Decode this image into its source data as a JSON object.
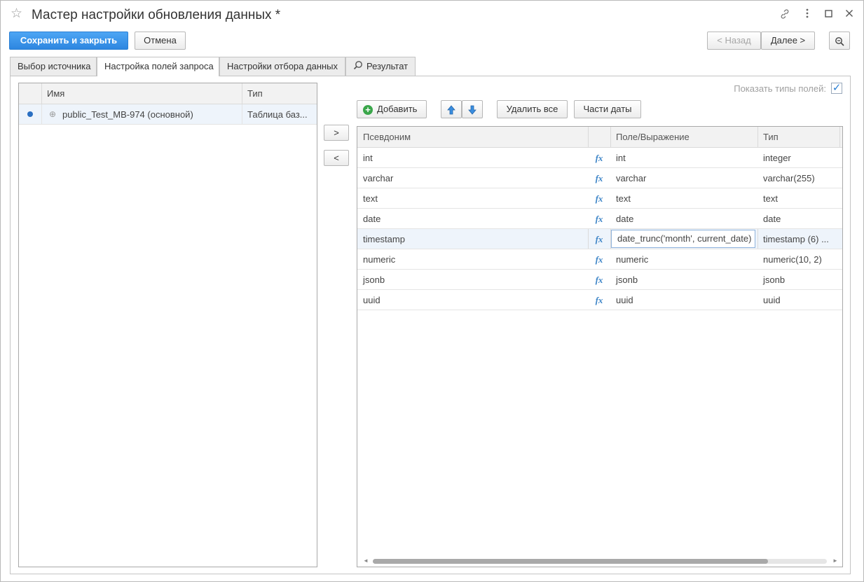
{
  "window": {
    "title": "Мастер настройки обновления данных *",
    "icons": [
      "star-icon",
      "link-icon",
      "more-icon",
      "maximize-icon",
      "close-icon"
    ]
  },
  "toolbar": {
    "save_close": "Сохранить и закрыть",
    "cancel": "Отмена",
    "back": "< Назад",
    "next": "Далее >",
    "zoom_icon": "magnifier-icon"
  },
  "tabs": [
    {
      "label": "Выбор источника"
    },
    {
      "label": "Настройка полей запроса",
      "active": true
    },
    {
      "label": "Настройки отбора данных"
    },
    {
      "label": "Результат",
      "icon": "search-icon"
    }
  ],
  "left_table": {
    "headers": [
      "Имя",
      "Тип"
    ],
    "rows": [
      {
        "name": "public_Test_MB-974 (основной)",
        "type": "Таблица баз..."
      }
    ]
  },
  "move": {
    "right": ">",
    "left": "<"
  },
  "right_panel": {
    "show_types_label": "Показать типы полей:",
    "show_types_checked": true,
    "add": "Добавить",
    "delete_all": "Удалить все",
    "date_parts": "Части даты",
    "headers": [
      "Псевдоним",
      "Поле/Выражение",
      "Тип"
    ],
    "fx_label": "fx",
    "rows": [
      {
        "alias": "int",
        "expr": "int",
        "type": "integer"
      },
      {
        "alias": "varchar",
        "expr": "varchar",
        "type": "varchar(255)"
      },
      {
        "alias": "text",
        "expr": "text",
        "type": "text"
      },
      {
        "alias": "date",
        "expr": "date",
        "type": "date"
      },
      {
        "alias": "timestamp",
        "expr": "date_trunc('month', current_date)",
        "type": "timestamp (6) ..."
      },
      {
        "alias": "numeric",
        "expr": "numeric",
        "type": "numeric(10, 2)"
      },
      {
        "alias": "jsonb",
        "expr": "jsonb",
        "type": "jsonb"
      },
      {
        "alias": "uuid",
        "expr": "uuid",
        "type": "uuid"
      }
    ]
  },
  "colors": {
    "primary": "#2d86e0",
    "accent_icon": "#3f86c8",
    "selection": "#eef4fb",
    "add_icon": "#3aa64a"
  }
}
